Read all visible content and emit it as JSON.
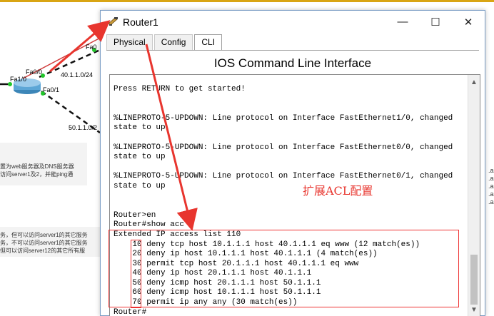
{
  "window": {
    "title": "Router1",
    "minimize_glyph": "—",
    "maximize_glyph": "☐",
    "close_glyph": "✕"
  },
  "tabs": [
    {
      "label": "Physical"
    },
    {
      "label": "Config"
    },
    {
      "label": "CLI",
      "active": true
    }
  ],
  "cli_heading": "IOS Command Line Interface",
  "terminal_lines": [
    "Press RETURN to get started!",
    "",
    "",
    "%LINEPROTO-5-UPDOWN: Line protocol on Interface FastEthernet1/0, changed",
    "state to up",
    "",
    "%LINEPROTO-5-UPDOWN: Line protocol on Interface FastEthernet0/0, changed",
    "state to up",
    "",
    "%LINEPROTO-5-UPDOWN: Line protocol on Interface FastEthernet0/1, changed",
    "state to up",
    "",
    "",
    "Router>en",
    "Router#show acc",
    "Extended IP access list 110",
    "    10 deny tcp host 10.1.1.1 host 40.1.1.1 eq www (12 match(es))",
    "    20 deny ip host 10.1.1.1 host 40.1.1.1 (4 match(es))",
    "    30 permit tcp host 20.1.1.1 host 40.1.1.1 eq www",
    "    40 deny ip host 20.1.1.1 host 40.1.1.1",
    "    50 deny icmp host 20.1.1.1 host 50.1.1.1",
    "    60 deny icmp host 10.1.1.1 host 50.1.1.1",
    "    70 permit ip any any (30 match(es))",
    "Router#"
  ],
  "annotation_text": "扩展ACL配置",
  "workspace": {
    "labels": {
      "fa0_top": "Fa0",
      "fa00": "Fa0/0",
      "fa10": "Fa1/0",
      "net40": "40.1.1.0/24",
      "fa01": "Fa0/1",
      "net50": "50.1.1.0/2"
    },
    "note1": [
      "置为web服务器及DNS服务器",
      "访问server1及2，并能ping通"
    ],
    "note2": [
      "务，但可以访问server1的其它服务",
      "务，不可以访问server1的其它服务",
      "但可以访问server12的其它所有服"
    ],
    "right_edge": [
      ".a",
      ".a",
      ".a",
      ".a",
      ".a"
    ]
  },
  "colors": {
    "annotation_red": "#e8352e",
    "link_green": "#21c52a",
    "window_border": "#7a9cc4"
  },
  "icons": {
    "title_icon": "router-icon",
    "scroll_up": "chevron-up-icon",
    "scroll_down": "chevron-down-icon"
  }
}
